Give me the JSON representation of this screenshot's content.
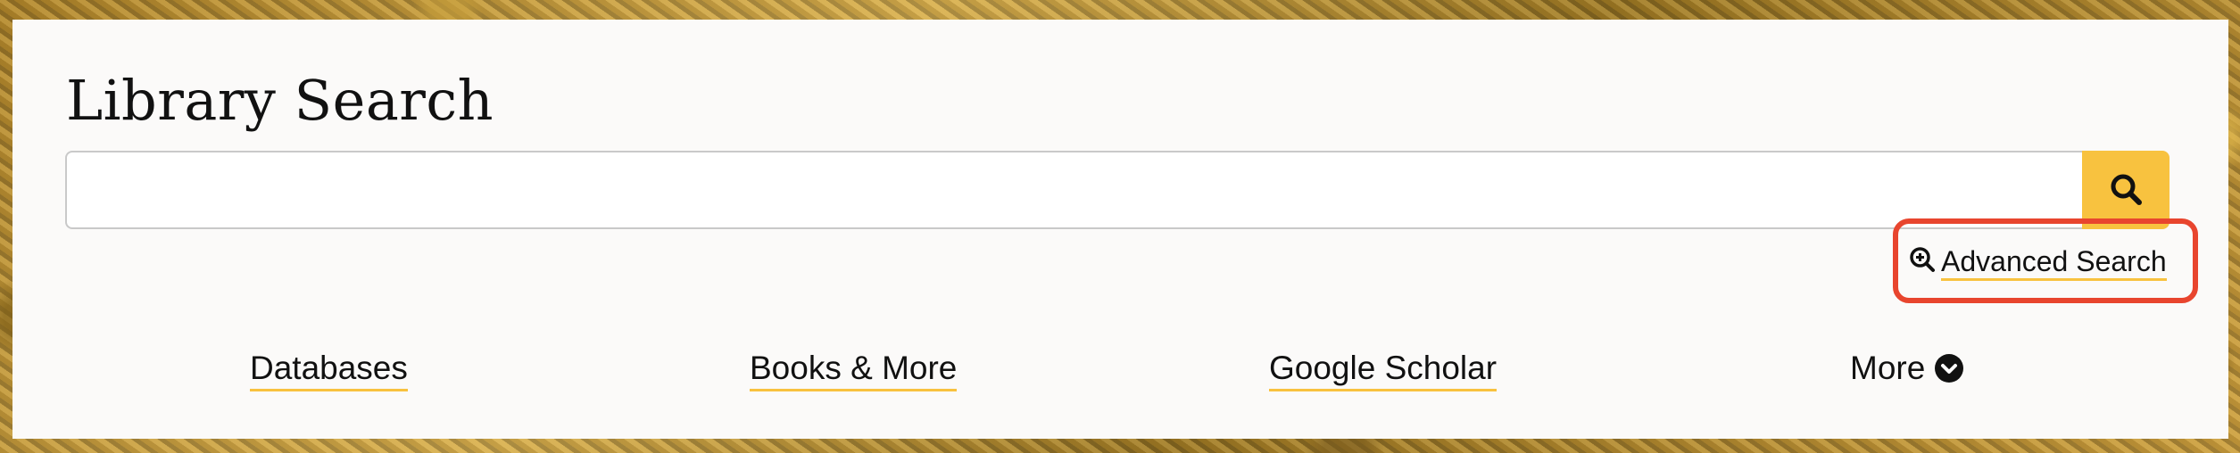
{
  "search": {
    "title": "Library Search",
    "input_value": "",
    "input_placeholder": "",
    "button_icon": "search-icon",
    "advanced_icon": "zoom-in-icon",
    "advanced_label": "Advanced Search"
  },
  "nav": {
    "databases": "Databases",
    "books": "Books & More",
    "scholar": "Google Scholar",
    "more": "More",
    "more_icon": "chevron-down-circle-icon"
  },
  "colors": {
    "accent": "#f8c23f",
    "highlight_box": "#e8452e",
    "panel": "#fbfaf9",
    "text": "#111111"
  }
}
